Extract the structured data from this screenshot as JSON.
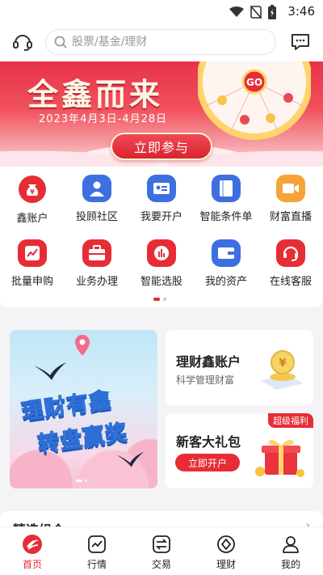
{
  "status_bar": {
    "time": "3:46"
  },
  "search": {
    "placeholder": "股票/基金/理财"
  },
  "banner": {
    "title": "全鑫而来",
    "date_range": "2023年4月3日-4月28日",
    "wheel_center": "GO",
    "cta_label": "立即参与"
  },
  "menu": {
    "items": [
      {
        "label": "鑫账户",
        "icon": "money-bag-icon",
        "color": "#e62d36"
      },
      {
        "label": "投顾社区",
        "icon": "advisor-icon",
        "color": "#3d6fe0"
      },
      {
        "label": "我要开户",
        "icon": "id-card-icon",
        "color": "#3d6fe0"
      },
      {
        "label": "智能条件单",
        "icon": "book-icon",
        "color": "#3d6fe0"
      },
      {
        "label": "财富直播",
        "icon": "video-icon",
        "color": "#f6a33a"
      },
      {
        "label": "批量申购",
        "icon": "trend-icon",
        "color": "#e62d36"
      },
      {
        "label": "业务办理",
        "icon": "briefcase-icon",
        "color": "#e62d36"
      },
      {
        "label": "智能选股",
        "icon": "stock-pick-icon",
        "color": "#e62d36"
      },
      {
        "label": "我的资产",
        "icon": "wallet-icon",
        "color": "#3d6fe0"
      },
      {
        "label": "在线客服",
        "icon": "headset-icon",
        "color": "#e62d36"
      }
    ]
  },
  "promo": {
    "left_line1": "理财有鑫",
    "left_line2": "转盘赢奖",
    "card1": {
      "title": "理财鑫账户",
      "subtitle": "科学管理财富"
    },
    "card2": {
      "title": "新客大礼包",
      "badge": "超级福利",
      "button": "立即开户"
    }
  },
  "next_section": {
    "title": "精选组合",
    "more": "›"
  },
  "tabbar": {
    "items": [
      {
        "label": "首页",
        "active": true
      },
      {
        "label": "行情",
        "active": false
      },
      {
        "label": "交易",
        "active": false
      },
      {
        "label": "理财",
        "active": false
      },
      {
        "label": "我的",
        "active": false
      }
    ]
  },
  "colors": {
    "brand_red": "#e62d36",
    "brand_blue": "#3d6fe0",
    "brand_orange": "#f6a33a"
  }
}
